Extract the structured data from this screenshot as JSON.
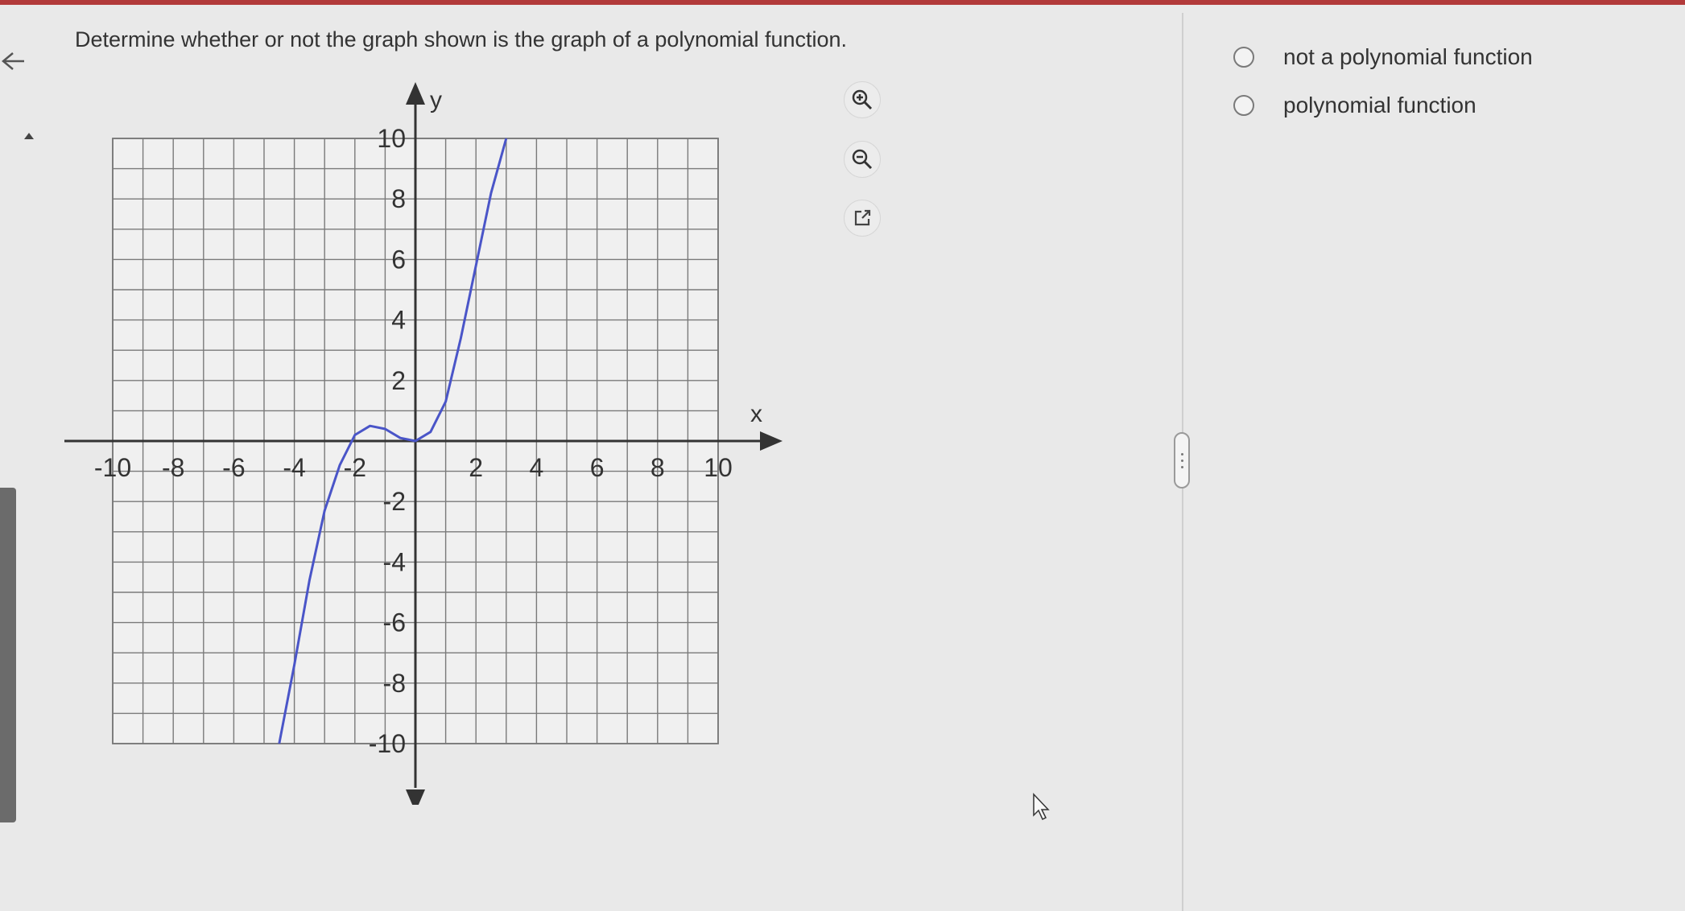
{
  "question": "Determine whether or not the graph shown is the graph of a polynomial function.",
  "tools": {
    "zoom_in": "zoom-in-icon",
    "zoom_out": "zoom-out-icon",
    "popout": "external-link-icon"
  },
  "options": [
    {
      "label": "not a polynomial function",
      "selected": false
    },
    {
      "label": "polynomial function",
      "selected": false
    }
  ],
  "chart_data": {
    "type": "line",
    "xlabel": "x",
    "ylabel": "y",
    "xlim": [
      -10,
      10
    ],
    "ylim": [
      -10,
      10
    ],
    "grid": true,
    "x_ticks": [
      "-10",
      "-8",
      "-6",
      "-4",
      "-2",
      "2",
      "4",
      "6",
      "8",
      "10"
    ],
    "y_ticks": [
      "10",
      "8",
      "6",
      "4",
      "2",
      "-2",
      "-4",
      "-6",
      "-8",
      "-10"
    ],
    "series": [
      {
        "color": "#4a55c8",
        "x": [
          -4.5,
          -4,
          -3.5,
          -3,
          -2.5,
          -2,
          -1.5,
          -1,
          -0.5,
          0,
          0.5,
          1,
          1.5,
          2,
          2.5,
          3
        ],
        "y": [
          -10,
          -7.4,
          -4.6,
          -2.3,
          -0.8,
          0.2,
          0.5,
          0.4,
          0.1,
          0,
          0.3,
          1.3,
          3.4,
          5.8,
          8.2,
          10
        ]
      }
    ]
  },
  "colors": {
    "accent": "#b23a3a",
    "curve": "#4a55c8",
    "grid": "#7a7a7a"
  }
}
